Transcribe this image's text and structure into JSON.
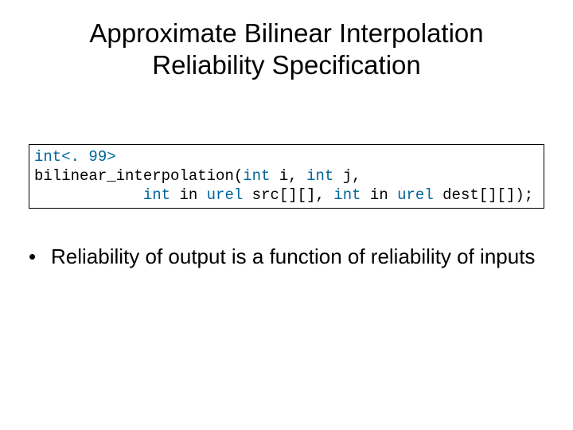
{
  "title_line1": "Approximate Bilinear Interpolation",
  "title_line2": "Reliability Specification",
  "code": {
    "reliability_spec": "int<. 99>",
    "sig_part1": "bilinear_interpolation(",
    "kw_int1": "int",
    "sig_part2": " i, ",
    "kw_int2": "int",
    "sig_part3": " j,",
    "indent": "            ",
    "kw_int3": "int",
    "kw_in1": " in ",
    "kw_urel1": "urel",
    "param_src": " src[][], ",
    "kw_int4": "int",
    "kw_in2": " in ",
    "kw_urel2": "urel",
    "param_dest": " dest[][]);"
  },
  "bullet": {
    "marker": "•",
    "text": "Reliability of output is a function of reliability of inputs"
  }
}
